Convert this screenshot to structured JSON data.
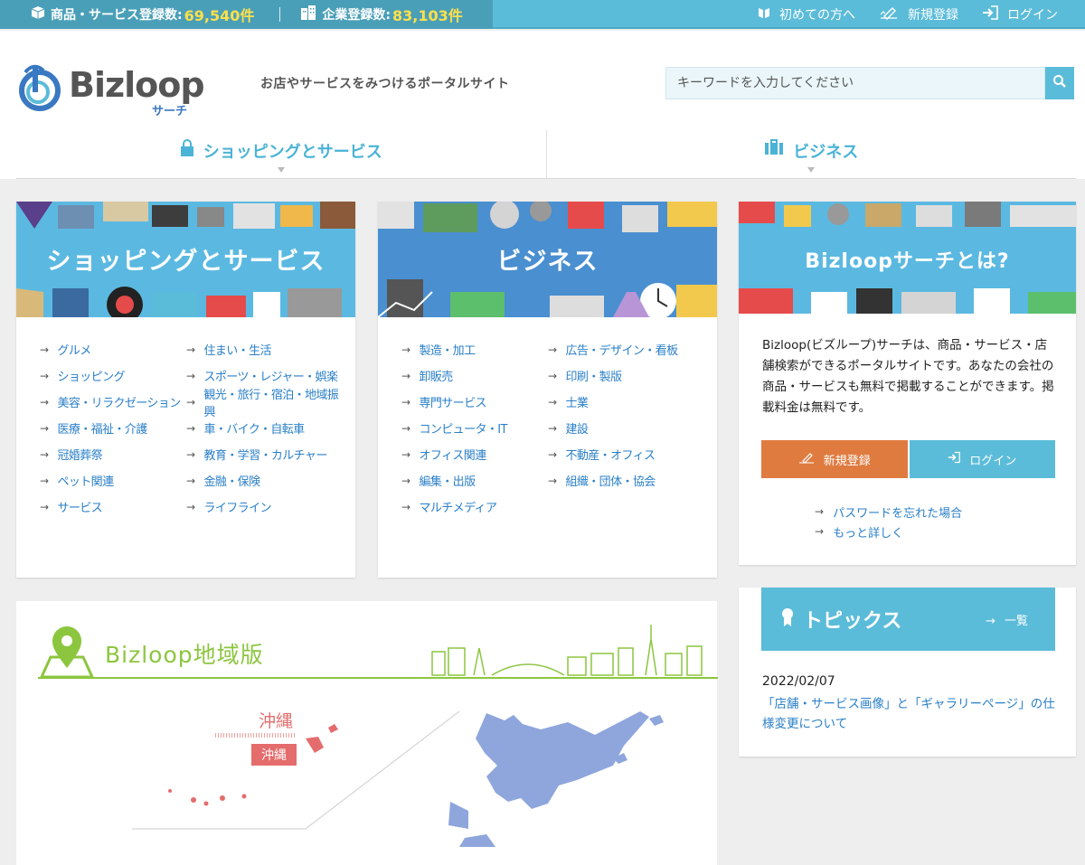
{
  "topbar": {
    "products_label": "商品・サービス登録数:",
    "products_count": "69,540件",
    "companies_label": "企業登録数:",
    "companies_count": "83,103件",
    "links": [
      {
        "label": "初めての方へ",
        "icon": "book-icon"
      },
      {
        "label": "新規登録",
        "icon": "pencil-icon"
      },
      {
        "label": "ログイン",
        "icon": "login-icon"
      }
    ]
  },
  "header": {
    "logo_text": "Bizloop",
    "logo_sub": "サーチ",
    "tagline": "お店やサービスをみつけるポータルサイト",
    "search_placeholder": "キーワードを入力してください",
    "tabs": [
      {
        "label": "ショッピングとサービス",
        "icon": "bag-icon"
      },
      {
        "label": "ビジネス",
        "icon": "briefcase-icon"
      }
    ]
  },
  "shopping": {
    "banner_title": "ショッピングとサービス",
    "links": [
      "グルメ",
      "住まい・生活",
      "ショッピング",
      "スポーツ・レジャー・娯楽",
      "美容・リラクゼーション",
      "観光・旅行・宿泊・地域振興",
      "医療・福祉・介護",
      "車・バイク・自転車",
      "冠婚葬祭",
      "教育・学習・カルチャー",
      "ペット関連",
      "金融・保険",
      "サービス",
      "ライフライン"
    ]
  },
  "business": {
    "banner_title": "ビジネス",
    "links": [
      "製造・加工",
      "広告・デザイン・看板",
      "卸販売",
      "印刷・製版",
      "専門サービス",
      "士業",
      "コンピュータ・IT",
      "建設",
      "オフィス関連",
      "不動産・オフィス",
      "編集・出版",
      "組織・団体・協会",
      "マルチメディア",
      ""
    ]
  },
  "about": {
    "banner_title": "Bizloopサーチとは?",
    "text": "Bizloop(ビズループ)サーチは、商品・サービス・店舗検索ができるポータルサイトです。あなたの会社の商品・サービスも無料で掲載することができます。掲載料金は無料です。",
    "register_label": "新規登録",
    "login_label": "ログイン",
    "links": [
      "パスワードを忘れた場合",
      "もっと詳しく"
    ]
  },
  "topics": {
    "title": "トピックス",
    "more_label": "一覧",
    "date": "2022/02/07",
    "item_title": "「店舗・サービス画像」と「ギャラリーページ」の仕様変更について"
  },
  "region": {
    "title": "Bizloop地域版",
    "okinawa_label": "沖縄",
    "okinawa_button": "沖縄"
  },
  "colors": {
    "accent": "#5bbcd9",
    "link": "#2a7fc8",
    "orange": "#e07b40",
    "green": "#8cc63f",
    "map_blue": "#8ea6dc",
    "okinawa": "#e56c6c"
  }
}
